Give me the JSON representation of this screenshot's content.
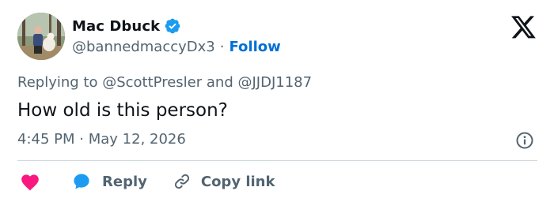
{
  "author": {
    "display_name": "Mac Dbuck",
    "handle": "@bannedmaccyDx3",
    "separator": "·",
    "follow_label": "Follow"
  },
  "tweet": {
    "replying_prefix": "Replying to",
    "mention_1": "@ScottPresler",
    "joiner": "and",
    "mention_2": "@JJDJ1187",
    "text": "How old is this person?",
    "time": "4:45 PM",
    "date_separator": "·",
    "date": "May 12, 2026"
  },
  "actions": {
    "reply_label": "Reply",
    "copy_link_label": "Copy link"
  },
  "icons": [
    "verified-badge-icon",
    "x-logo-icon",
    "info-icon",
    "heart-icon",
    "reply-bubble-icon",
    "link-icon"
  ],
  "colors": {
    "text": "#0f1419",
    "secondary": "#536471",
    "link": "#006fd6",
    "verified": "#1d9bf0",
    "heart": "#f91880",
    "reply_bubble": "#1d9bf0",
    "divider": "#cfd9de"
  }
}
